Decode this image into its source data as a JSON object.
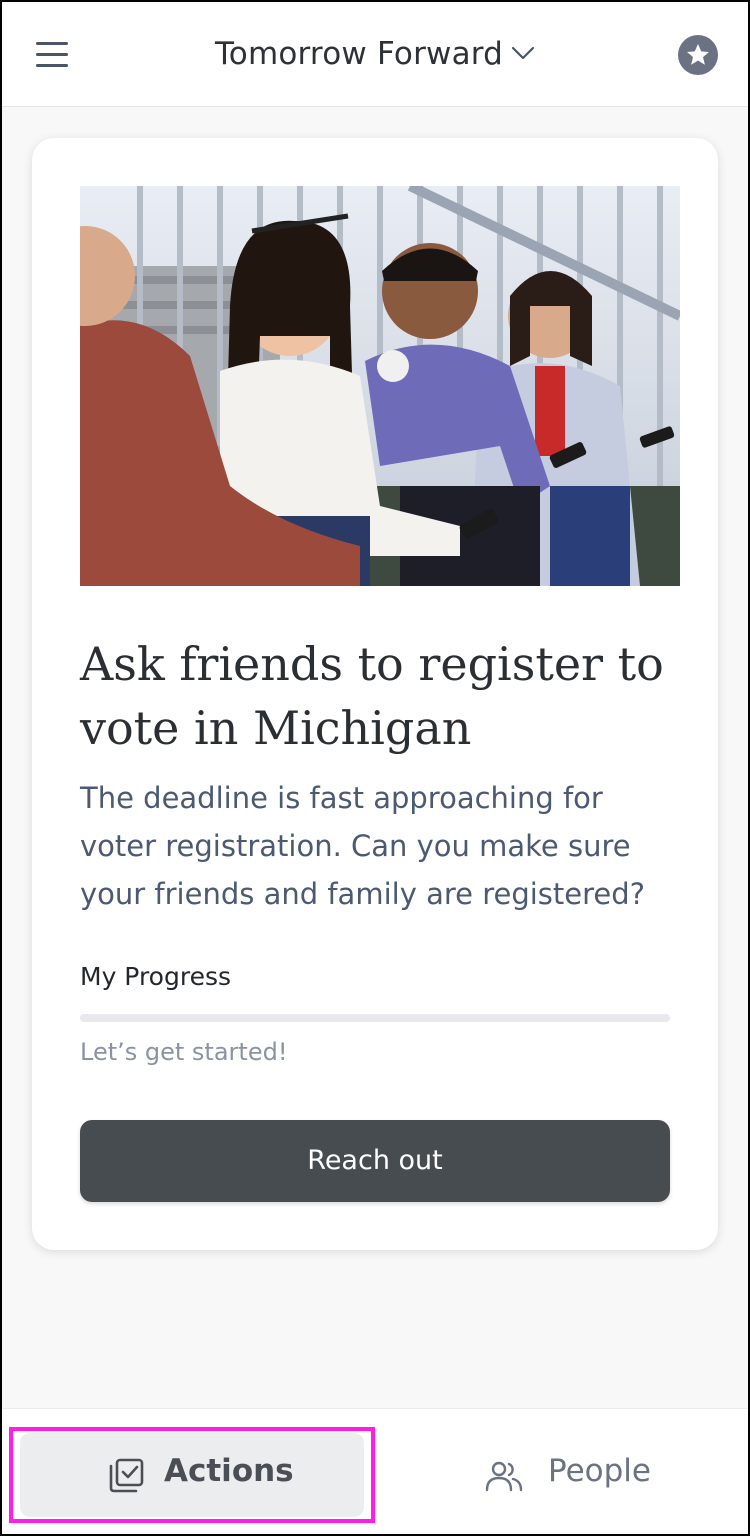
{
  "header": {
    "menu_icon": "hamburger-menu-icon",
    "title": "Tomorrow Forward",
    "dropdown_icon": "chevron-down-icon",
    "favorite_icon": "star-icon"
  },
  "card": {
    "image_alt": "Four young people sitting on outdoor steps looking at their phones",
    "title": "Ask friends to register to vote in Michigan",
    "description": "The deadline is fast approaching for voter registration. Can you make sure your friends and family are registered?",
    "progress": {
      "label": "My Progress",
      "fraction": 0,
      "status": "Let’s get started!"
    },
    "button_label": "Reach out"
  },
  "tabs": [
    {
      "label": "Actions",
      "icon": "checklist-icon",
      "selected": true
    },
    {
      "label": "People",
      "icon": "people-icon",
      "selected": false
    }
  ],
  "colors": {
    "button_bg": "#474c51",
    "selected_tab_bg": "#ecedef",
    "highlight_outline": "#ff1ee8",
    "icon_gray": "#6b7283"
  }
}
